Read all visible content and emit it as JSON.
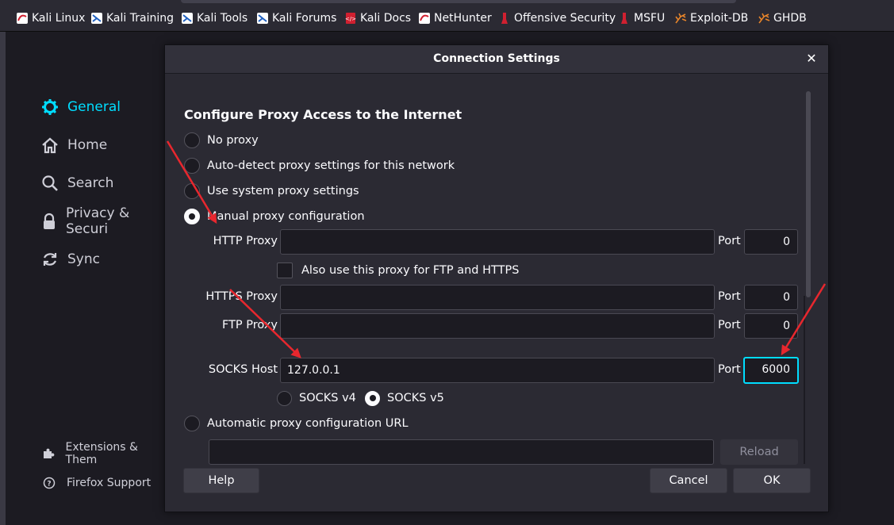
{
  "bookmarks": [
    {
      "label": "Kali Linux",
      "icon": "kali-dragon-icon"
    },
    {
      "label": "Kali Training",
      "icon": "kali-training-icon"
    },
    {
      "label": "Kali Tools",
      "icon": "kali-tools-icon"
    },
    {
      "label": "Kali Forums",
      "icon": "kali-forums-icon"
    },
    {
      "label": "Kali Docs",
      "icon": "kali-docs-icon"
    },
    {
      "label": "NetHunter",
      "icon": "nethunter-icon"
    },
    {
      "label": "Offensive Security",
      "icon": "offsec-icon"
    },
    {
      "label": "MSFU",
      "icon": "msfu-icon"
    },
    {
      "label": "Exploit-DB",
      "icon": "exploitdb-spider-icon"
    },
    {
      "label": "GHDB",
      "icon": "ghdb-spider-icon"
    }
  ],
  "sidebar": {
    "items": [
      {
        "label": "General",
        "icon": "gear-icon",
        "active": true
      },
      {
        "label": "Home",
        "icon": "home-icon"
      },
      {
        "label": "Search",
        "icon": "search-icon"
      },
      {
        "label": "Privacy & Securi",
        "icon": "lock-icon"
      },
      {
        "label": "Sync",
        "icon": "sync-icon"
      }
    ],
    "footer": [
      {
        "label": "Extensions & Them",
        "icon": "puzzle-icon"
      },
      {
        "label": "Firefox Support",
        "icon": "help-icon"
      }
    ]
  },
  "dialog": {
    "title": "Connection Settings",
    "close_glyph": "✕",
    "heading": "Configure Proxy Access to the Internet",
    "options": {
      "no_proxy": "No proxy",
      "auto_detect": "Auto-detect proxy settings for this network",
      "system": "Use system proxy settings",
      "manual": "Manual proxy configuration",
      "auto_url": "Automatic proxy configuration URL"
    },
    "selected_option": "manual",
    "http": {
      "label": "HTTP Proxy",
      "value": "",
      "port_label": "Port",
      "port": "0"
    },
    "also_use": {
      "label": "Also use this proxy for FTP and HTTPS",
      "checked": false
    },
    "https": {
      "label": "HTTPS Proxy",
      "value": "",
      "port_label": "Port",
      "port": "0"
    },
    "ftp": {
      "label": "FTP Proxy",
      "value": "",
      "port_label": "Port",
      "port": "0"
    },
    "socks": {
      "label": "SOCKS Host",
      "value": "127.0.0.1",
      "port_label": "Port",
      "port": "6000",
      "v4": "SOCKS v4",
      "v5": "SOCKS v5",
      "selected_version": "v5"
    },
    "auto_url_value": "",
    "reload_label": "Reload",
    "help_label": "Help",
    "cancel_label": "Cancel",
    "ok_label": "OK"
  },
  "colors": {
    "accent": "#00ddff",
    "annotation_arrow": "#e8272e",
    "dialog_bg": "#2b2a33",
    "page_bg": "#1c1b22"
  }
}
